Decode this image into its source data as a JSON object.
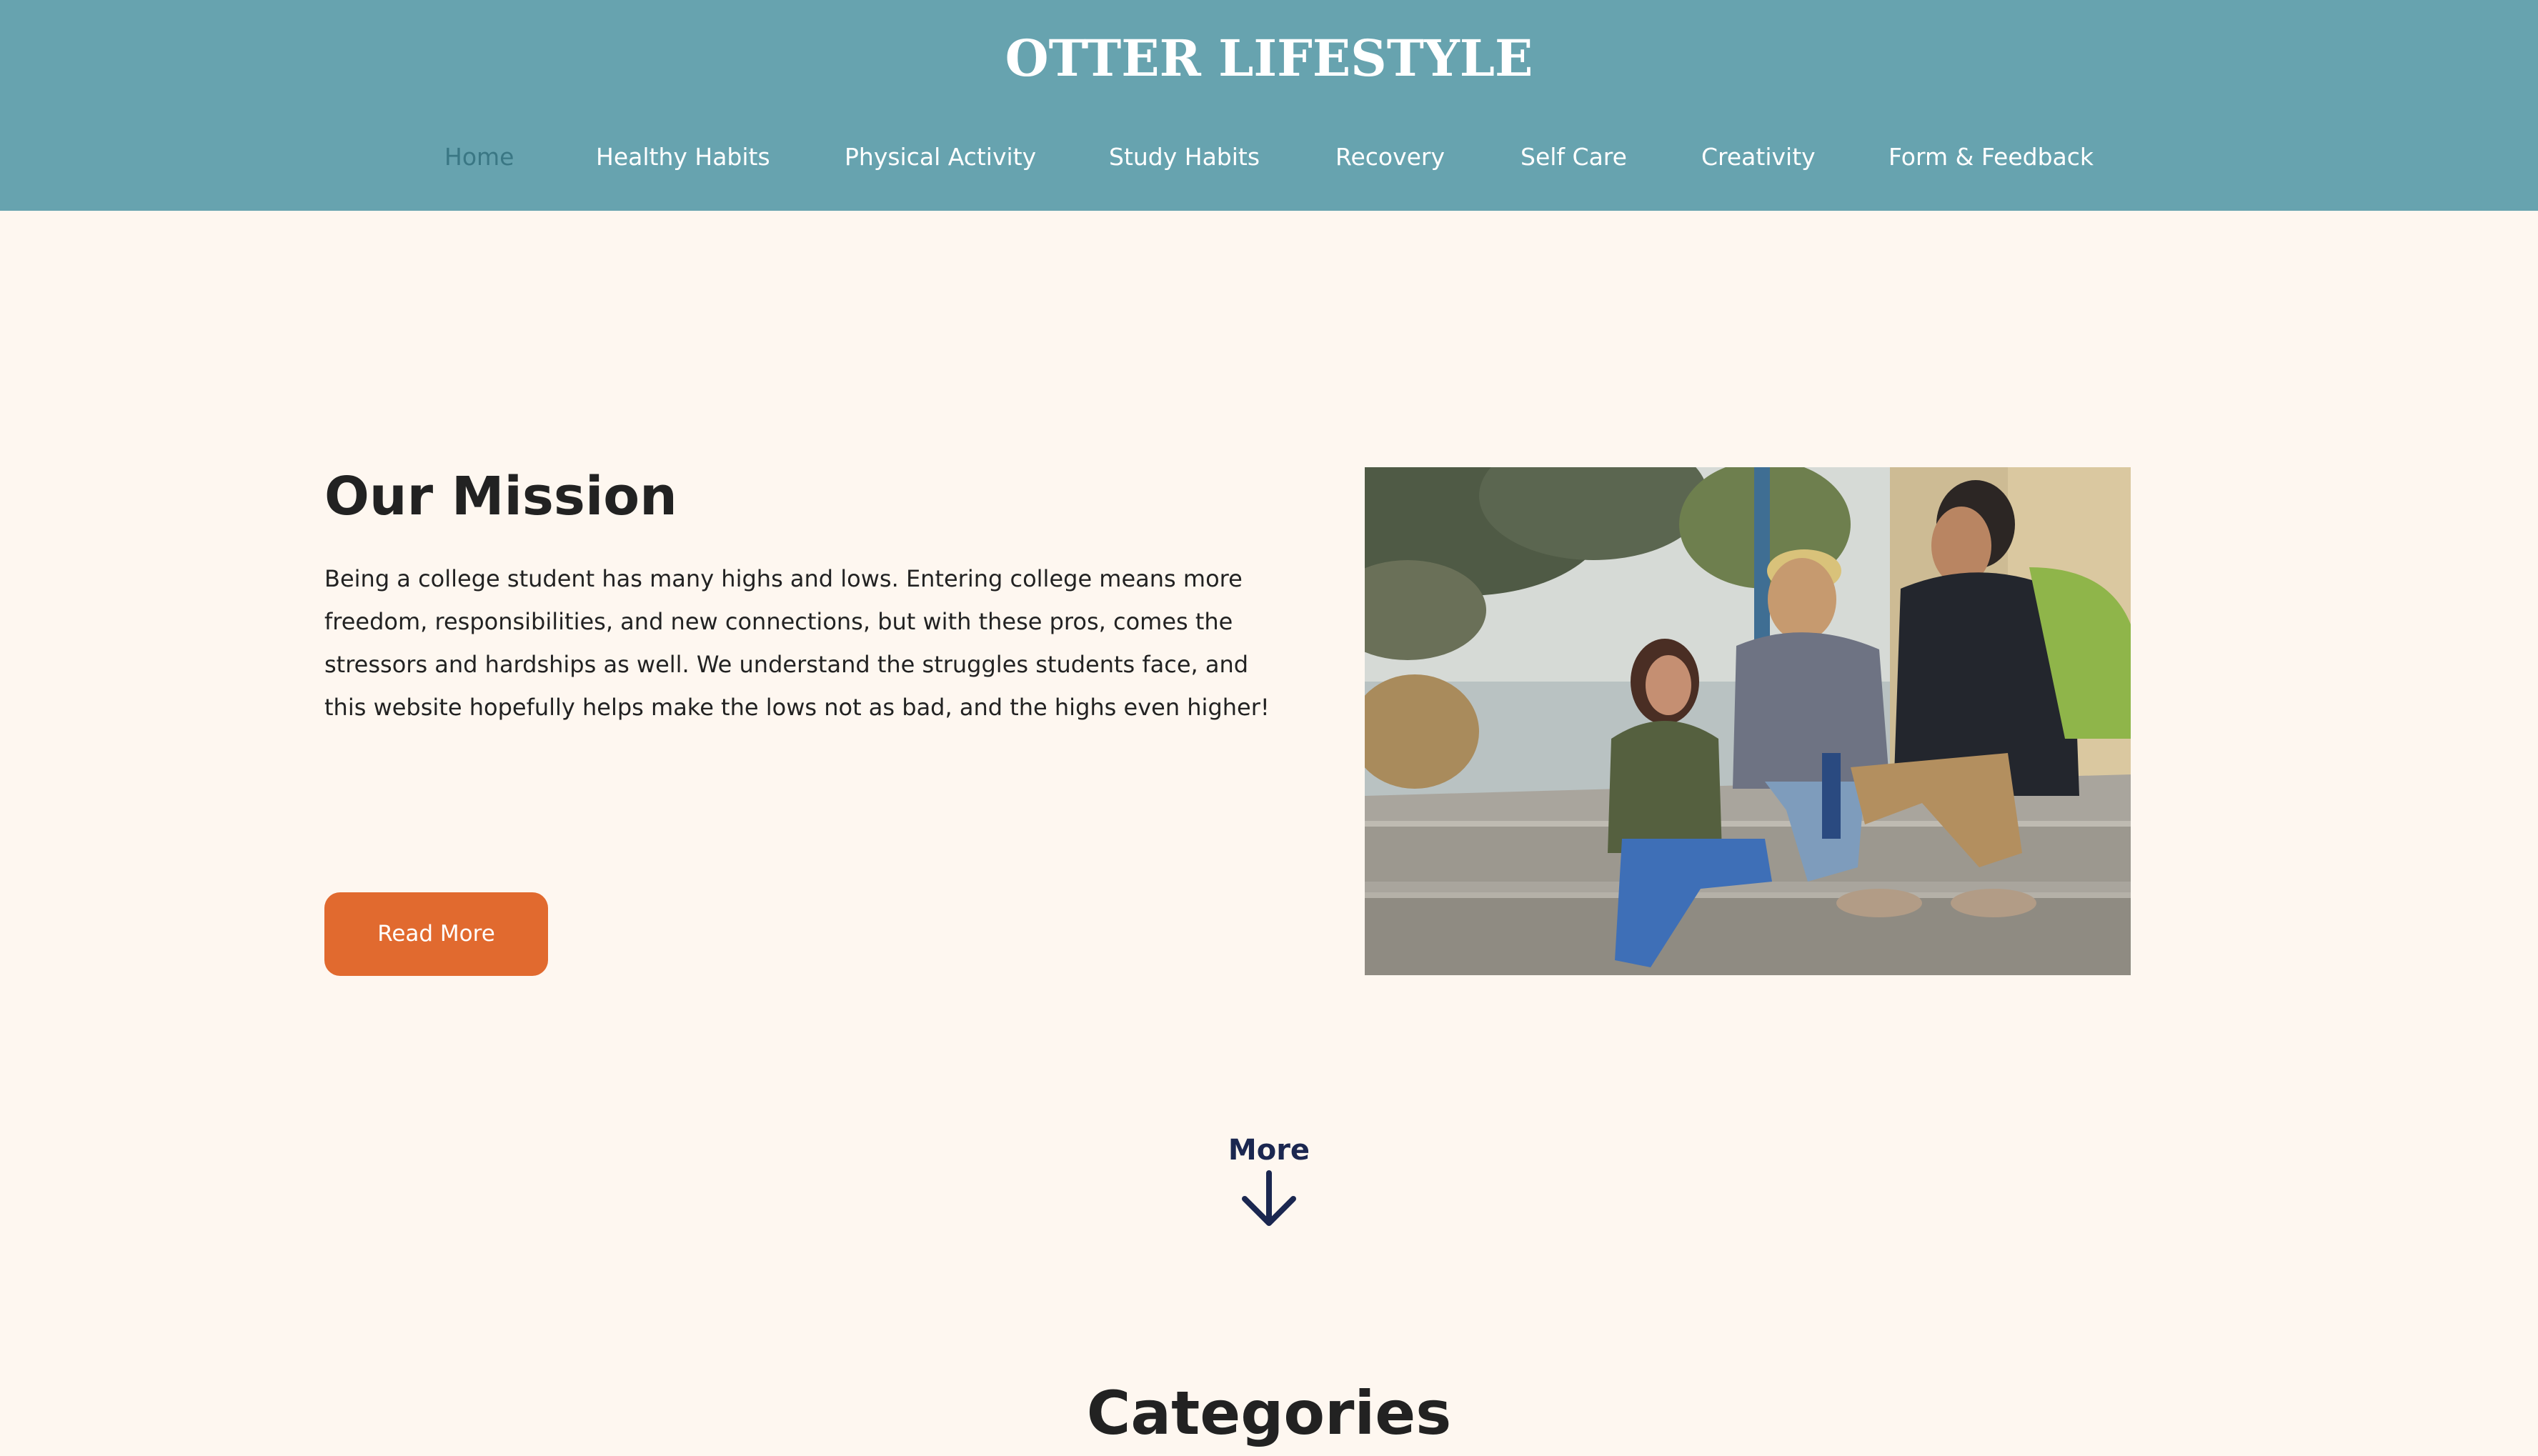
{
  "header": {
    "site_title": "OTTER LIFESTYLE",
    "background_color": "#67A3AF",
    "nav": [
      {
        "label": "Home",
        "active": true
      },
      {
        "label": "Healthy Habits",
        "active": false
      },
      {
        "label": "Physical Activity",
        "active": false
      },
      {
        "label": "Study Habits",
        "active": false
      },
      {
        "label": "Recovery",
        "active": false
      },
      {
        "label": "Self Care",
        "active": false
      },
      {
        "label": "Creativity",
        "active": false
      },
      {
        "label": "Form & Feedback",
        "active": false
      }
    ]
  },
  "mission": {
    "title": "Our Mission",
    "body": "Being a college student has many highs and lows. Entering college means more freedom, responsibilities, and new connections, but with these pros, comes the stressors and hardships as well. We understand the struggles students face, and this website hopefully helps make the lows not as bad, and the highs even higher!",
    "button_label": "Read More",
    "button_color": "#E16A2F"
  },
  "more": {
    "label": "More",
    "icon": "arrow-down-icon"
  },
  "categories": {
    "title": "Categories"
  },
  "colors": {
    "page_background": "#FEF7F0",
    "heading_text": "#222222",
    "more_text": "#1B2750",
    "active_nav_text": "#3A7784"
  }
}
